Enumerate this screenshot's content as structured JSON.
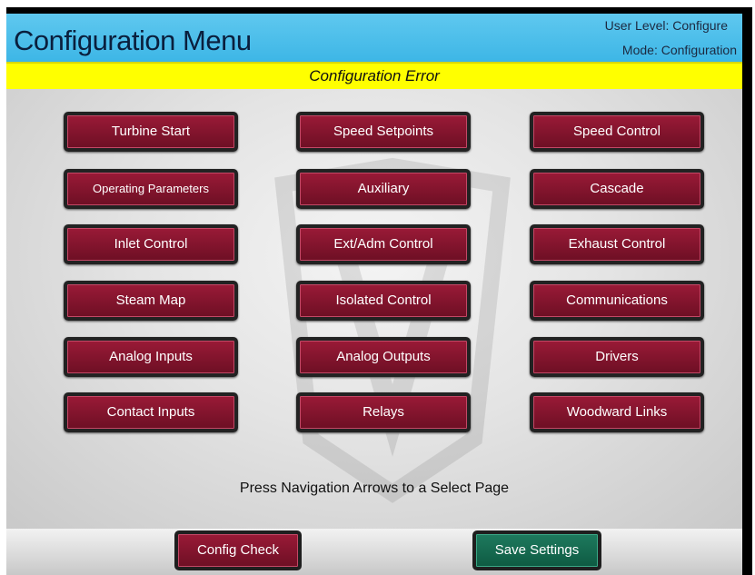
{
  "header": {
    "title": "Configuration Menu",
    "user_level": "User Level: Configure",
    "mode": "Mode: Configuration"
  },
  "status": {
    "error_text": "Configuration Error"
  },
  "menu": {
    "turbine_start": "Turbine Start",
    "speed_setpoints": "Speed Setpoints",
    "speed_control": "Speed Control",
    "operating_parameters": "Operating Parameters",
    "auxiliary": "Auxiliary",
    "cascade": "Cascade",
    "inlet_control": "Inlet Control",
    "ext_adm_control": "Ext/Adm Control",
    "exhaust_control": "Exhaust Control",
    "steam_map": "Steam Map",
    "isolated_control": "Isolated Control",
    "communications": "Communications",
    "analog_inputs": "Analog Inputs",
    "analog_outputs": "Analog Outputs",
    "drivers": "Drivers",
    "contact_inputs": "Contact Inputs",
    "relays": "Relays",
    "woodward_links": "Woodward Links"
  },
  "hint": "Press Navigation Arrows to a Select Page",
  "footer": {
    "config_check": "Config Check",
    "save_settings": "Save Settings"
  },
  "colors": {
    "title_bar": "#3db6e6",
    "error_bar": "#ffff00",
    "menu_button": "#80132c",
    "save_button": "#0e5a42"
  }
}
